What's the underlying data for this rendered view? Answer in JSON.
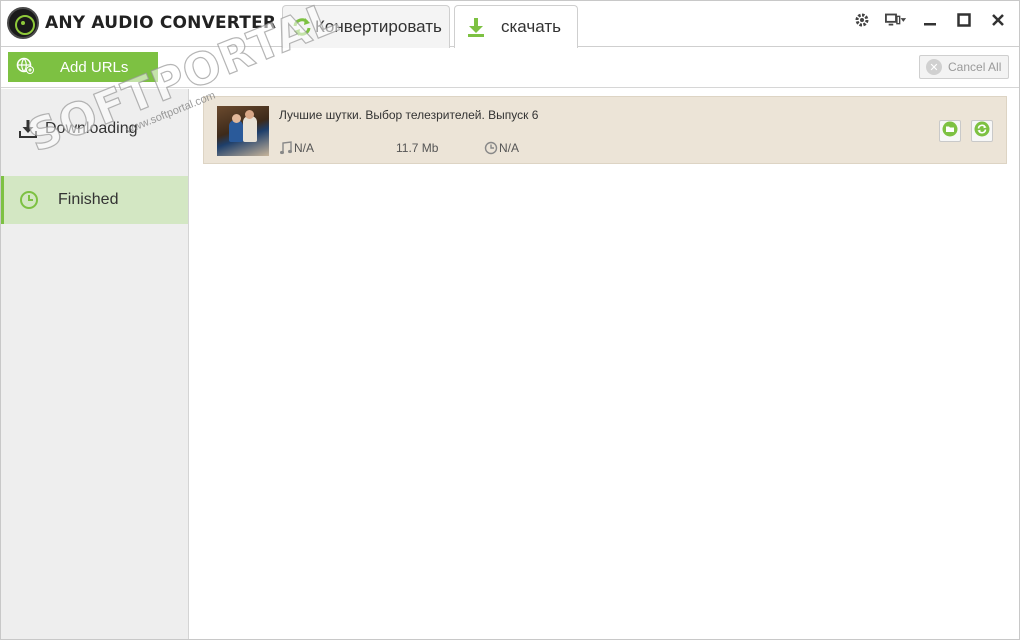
{
  "app": {
    "title": "ANY AUDIO CONVERTER"
  },
  "tabs": [
    {
      "label": "Конвертировать",
      "icon": "refresh-arrows-icon",
      "active": false
    },
    {
      "label": "скачать",
      "icon": "download-arrow-icon",
      "active": true
    }
  ],
  "window_controls": [
    "settings-gear-icon",
    "display-menu-icon",
    "minimize-icon",
    "maximize-icon",
    "close-icon"
  ],
  "toolbar": {
    "add_urls_label": "Add URLs",
    "cancel_all_label": "Cancel All"
  },
  "sidebar": {
    "items": [
      {
        "label": "Downloading",
        "icon": "download-tray-icon",
        "active": false
      },
      {
        "label": "Finished",
        "icon": "clock-icon",
        "active": true
      }
    ]
  },
  "downloads": [
    {
      "title": "Лучшие шутки. Выбор телезрителей. Выпуск 6",
      "audio": "N/A",
      "size": "11.7 Mb",
      "duration": "N/A"
    }
  ],
  "watermark": {
    "brand": "SOFTPORTAL",
    "url": "www.softportal.com"
  },
  "colors": {
    "accent_green": "#7dc142",
    "active_sidebar": "#d3e7c3",
    "row_background": "#ece4d7",
    "sidebar_background": "#eeeeee"
  }
}
